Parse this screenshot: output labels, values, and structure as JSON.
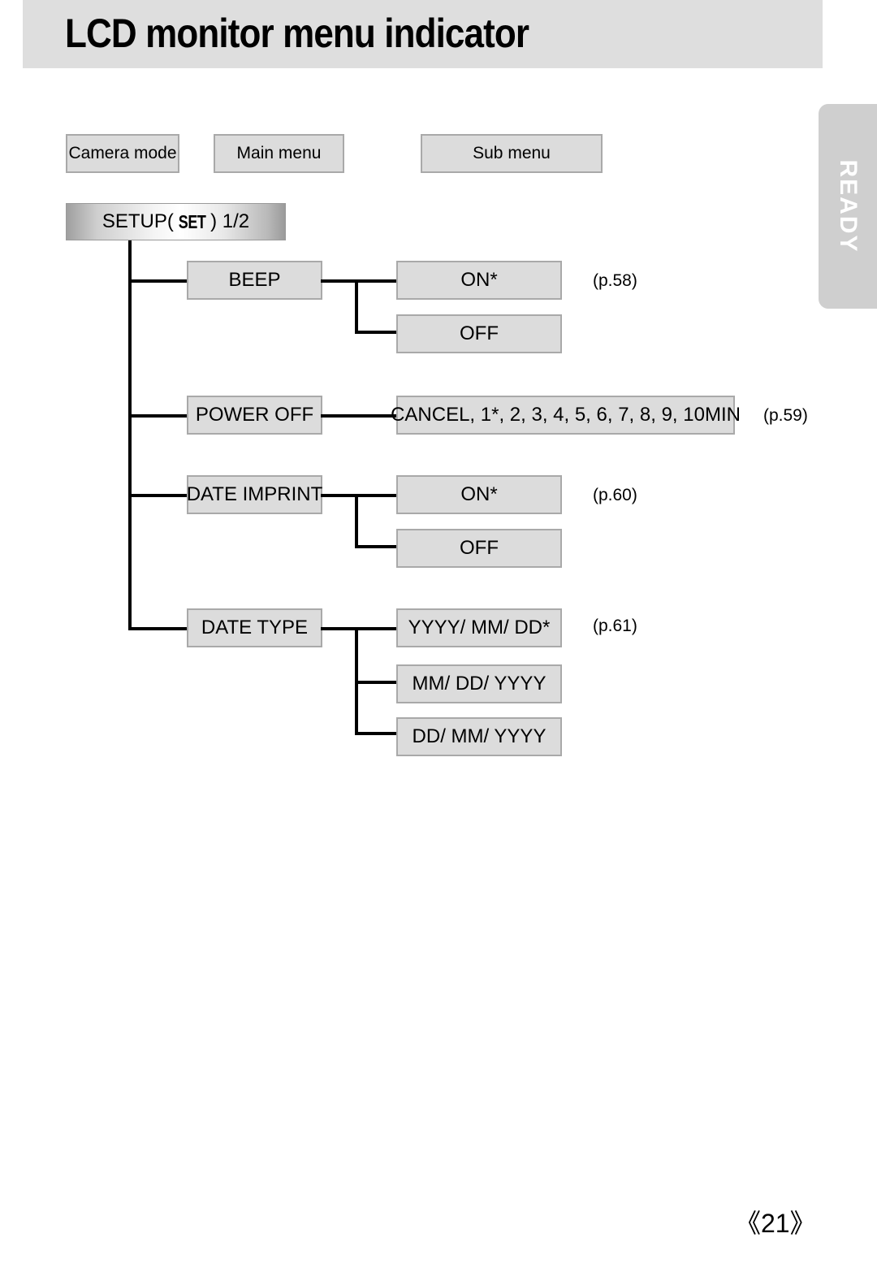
{
  "header": {
    "title": "LCD monitor menu indicator"
  },
  "side_tab": {
    "label": "READY"
  },
  "legend": {
    "camera_mode": "Camera mode",
    "main_menu": "Main menu",
    "sub_menu": "Sub menu"
  },
  "setup": {
    "prefix": "SETUP(",
    "icon_label": "SET",
    "suffix": ") 1/2"
  },
  "menus": [
    {
      "label": "BEEP",
      "page_ref": "(p.58)",
      "options": [
        "ON*",
        "OFF"
      ]
    },
    {
      "label": "POWER OFF",
      "page_ref": "(p.59)",
      "options": [
        "CANCEL, 1*, 2, 3, 4, 5, 6, 7, 8, 9, 10MIN"
      ]
    },
    {
      "label": "DATE IMPRINT",
      "page_ref": "(p.60)",
      "options": [
        "ON*",
        "OFF"
      ]
    },
    {
      "label": "DATE TYPE",
      "page_ref": "(p.61)",
      "options": [
        "YYYY/ MM/ DD*",
        "MM/ DD/ YYYY",
        "DD/ MM/ YYYY"
      ]
    }
  ],
  "footer": {
    "page_number": "《21》"
  },
  "colors": {
    "header_band": "#dedede",
    "box_fill": "#dcdcdc",
    "box_border": "#a9a9a9",
    "tab_fill": "#cfcfcf",
    "line": "#000000"
  }
}
